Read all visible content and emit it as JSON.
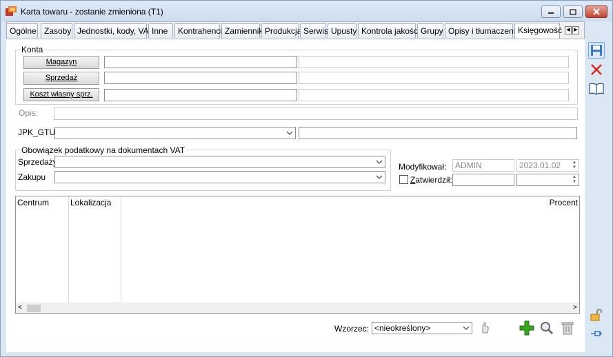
{
  "window": {
    "title": "Karta towaru - zostanie zmieniona (T1)"
  },
  "tabs": [
    {
      "label": "Ogólne"
    },
    {
      "label": "Zasoby"
    },
    {
      "label": "Jednostki, kody, VAT"
    },
    {
      "label": "Inne"
    },
    {
      "label": "Kontrahenci"
    },
    {
      "label": "Zamienniki"
    },
    {
      "label": "Produkcja"
    },
    {
      "label": "Serwis"
    },
    {
      "label": "Upusty"
    },
    {
      "label": "Kontrola jakości"
    },
    {
      "label": "Grupy"
    },
    {
      "label": "Opisy i tłumaczenia"
    },
    {
      "label": "Księgowość",
      "active": true
    }
  ],
  "konta": {
    "group_label": "Konta",
    "magazyn": {
      "label": "Magazyn",
      "value": "",
      "desc": ""
    },
    "sprzedaz": {
      "label": "Sprzedaż",
      "value": "",
      "desc": ""
    },
    "koszt": {
      "label": "Koszt własny sprz.",
      "value": "",
      "desc": ""
    }
  },
  "opis": {
    "label": "Opis:",
    "value": ""
  },
  "jpk": {
    "label": "JPK_GTU:",
    "value": "",
    "desc": ""
  },
  "vat": {
    "group_label": "Obowiązek podatkowy na dokumentach VAT",
    "sprzedazy_label": "Sprzedaży",
    "sprzedazy_value": "",
    "zakupu_label": "Zakupu",
    "zakupu_value": ""
  },
  "audit": {
    "modyfikowal_label": "Modyfikował:",
    "modyfikowal_user": "ADMIN",
    "modyfikowal_date": "2023.01.02",
    "zatwierdzil_label": "Zatwierdził:",
    "zatwierdzil_checked": false,
    "zatwierdzil_user": "",
    "zatwierdzil_date": ""
  },
  "grid": {
    "columns": [
      "Centrum",
      "Lokalizacja",
      "Procent"
    ]
  },
  "footer": {
    "wzorzec_label": "Wzorzec:",
    "wzorzec_value": "<nieokreślony>"
  },
  "colors": {
    "accent": "#3a78c8",
    "add": "#3aa51f",
    "delete": "#d9281c"
  }
}
